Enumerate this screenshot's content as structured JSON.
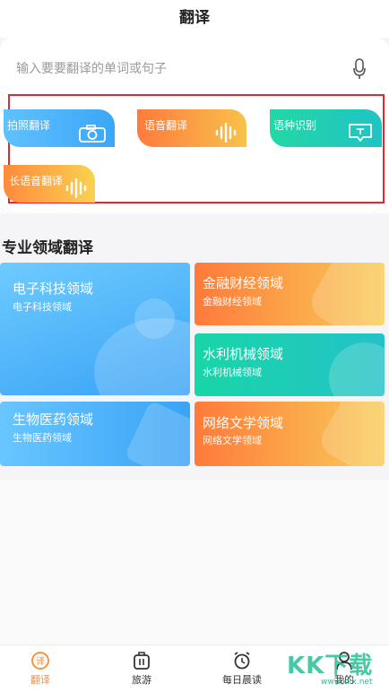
{
  "header": {
    "title": "翻译"
  },
  "search": {
    "placeholder": "输入要要翻译的单词或句子",
    "icon": "microphone-icon"
  },
  "tools": [
    {
      "label": "拍照翻译",
      "icon": "camera-icon",
      "color": "#3aa6f7"
    },
    {
      "label": "语音翻译",
      "icon": "sound-wave-icon",
      "color": "#ff7b3d"
    },
    {
      "label": "语种识别",
      "icon": "text-bubble-icon",
      "color": "#22d8a5"
    },
    {
      "label": "长语音翻译",
      "icon": "sound-wave-icon",
      "color": "#f9d250"
    }
  ],
  "fields_section": {
    "title": "专业领域翻译",
    "items": [
      {
        "name": "电子科技领域",
        "sub": "电子科技领域"
      },
      {
        "name": "金融财经领域",
        "sub": "金融财经领域"
      },
      {
        "name": "水利机械领域",
        "sub": "水利机械领域"
      },
      {
        "name": "生物医药领域",
        "sub": "生物医药领域"
      },
      {
        "name": "网络文学领域",
        "sub": "网络文学领域"
      }
    ]
  },
  "tabbar": {
    "items": [
      {
        "label": "翻译",
        "icon": "translate-icon",
        "active": true
      },
      {
        "label": "旅游",
        "icon": "luggage-icon",
        "active": false
      },
      {
        "label": "每日晨读",
        "icon": "alarm-clock-icon",
        "active": false
      },
      {
        "label": "我的",
        "icon": "user-icon",
        "active": false
      }
    ],
    "active_color": "#ff8a32"
  },
  "watermark": {
    "text": "KK下载",
    "url": "www.kkx.net"
  }
}
